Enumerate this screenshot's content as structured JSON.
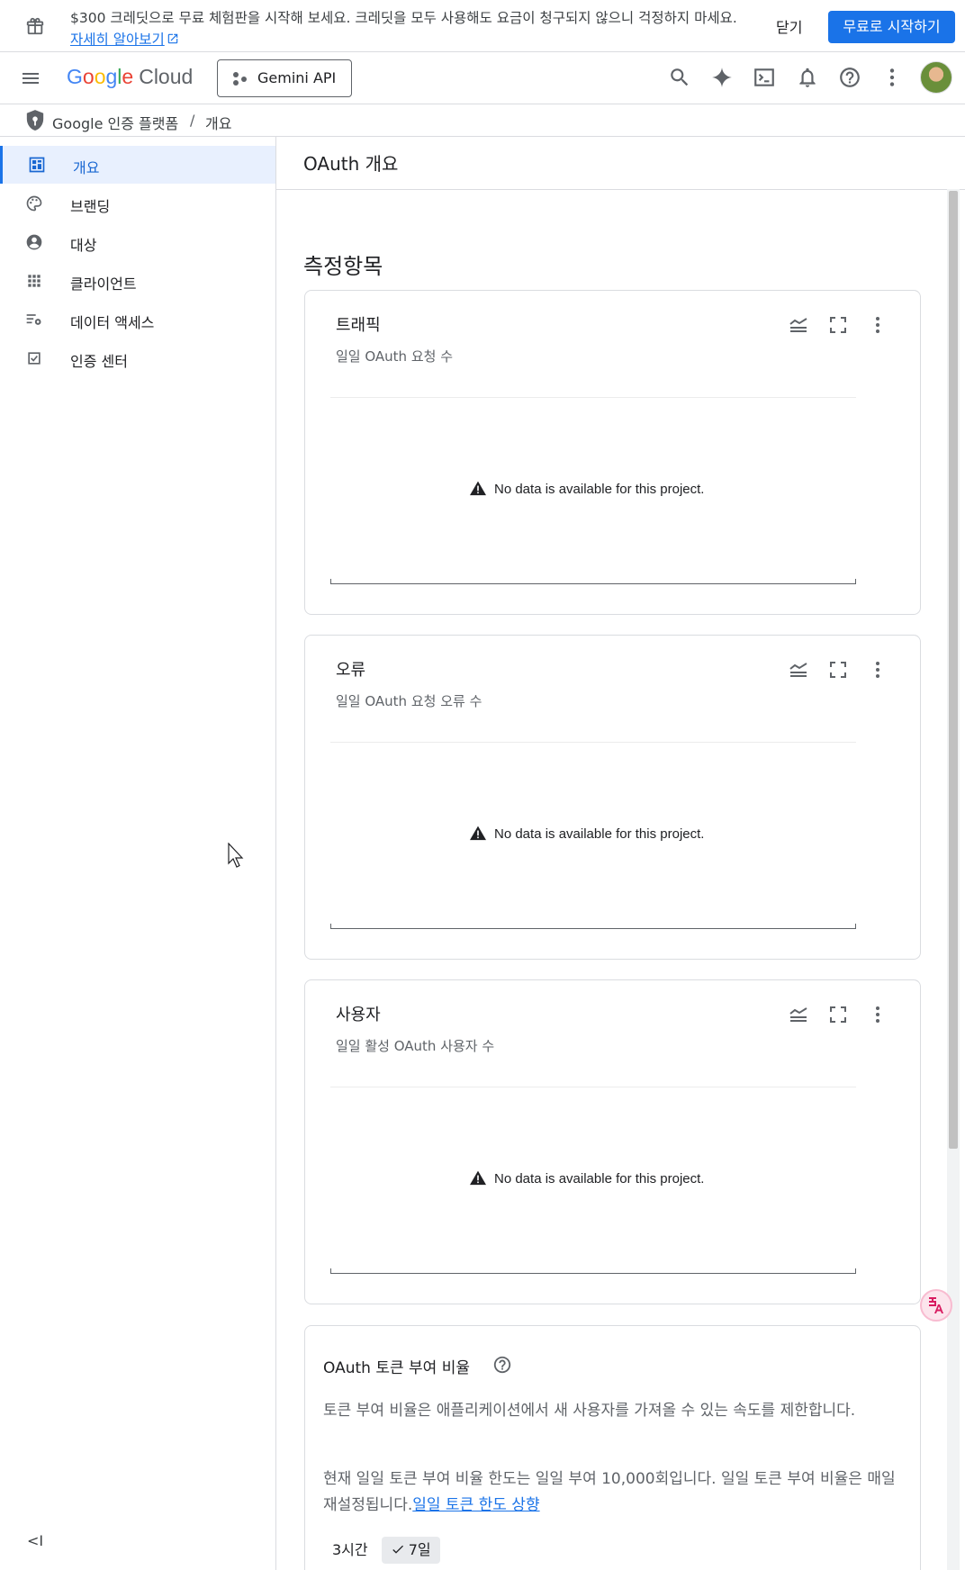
{
  "promo": {
    "message": "$300 크레딧으로 무료 체험판을 시작해 보세요. 크레딧을 모두 사용해도 요금이 청구되지 않으니 걱정하지 마세요.",
    "learn_more": "자세히 알아보기",
    "close_label": "닫기",
    "start_label": "무료로 시작하기"
  },
  "header": {
    "logo_g": [
      "G",
      "o",
      "o",
      "g",
      "l",
      "e"
    ],
    "logo_cloud": "Cloud",
    "project": "Gemini API",
    "icons": [
      "menu-icon",
      "search-icon",
      "gemini-spark-icon",
      "cloud-shell-icon",
      "notifications-icon",
      "help-icon",
      "more-vert-icon",
      "avatar"
    ]
  },
  "breadcrumb": {
    "product": "Google 인증 플랫폼",
    "separator": "/",
    "page": "개요"
  },
  "sidebar": {
    "items": [
      {
        "label": "개요",
        "icon": "dashboard-icon",
        "active": true
      },
      {
        "label": "브랜딩",
        "icon": "palette-icon",
        "active": false
      },
      {
        "label": "대상",
        "icon": "person-icon",
        "active": false
      },
      {
        "label": "클라이언트",
        "icon": "apps-icon",
        "active": false
      },
      {
        "label": "데이터 액세스",
        "icon": "data-settings-icon",
        "active": false
      },
      {
        "label": "인증 센터",
        "icon": "verified-checkbox-icon",
        "active": false
      }
    ],
    "collapse_label": "<I"
  },
  "main": {
    "page_title": "OAuth 개요",
    "section_title": "측정항목",
    "cards": [
      {
        "title": "트래픽",
        "subtitle": "일일 OAuth 요청 수",
        "empty": "No data is available for this project."
      },
      {
        "title": "오류",
        "subtitle": "일일 OAuth 요청 오류 수",
        "empty": "No data is available for this project."
      },
      {
        "title": "사용자",
        "subtitle": "일일 활성 OAuth 사용자 수",
        "empty": "No data is available for this project."
      }
    ],
    "grant_rate": {
      "title": "OAuth 토큰 부여 비율",
      "description": "토큰 부여 비율은 애플리케이션에서 새 사용자를 가져올 수 있는 속도를 제한합니다.",
      "current": "현재 일일 토큰 부여 비율 한도는 일일 부여 10,000회입니다. 일일 토큰 부여 비율은 매일 재설정됩니다.",
      "link": "일일 토큰 한도 상향",
      "chips": [
        "3시간",
        "7일"
      ],
      "selected_chip": "7일"
    }
  },
  "colors": {
    "accent": "#1a73e8",
    "active_bg": "#e8f0fe"
  }
}
